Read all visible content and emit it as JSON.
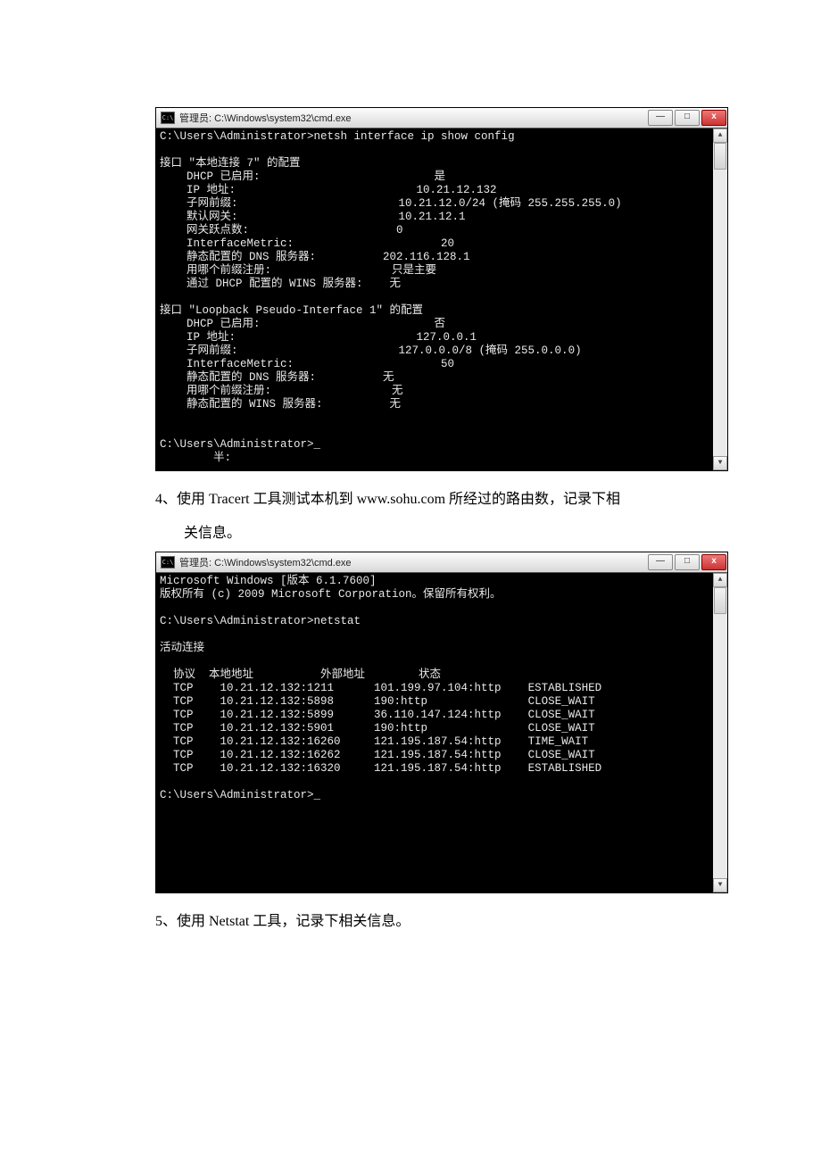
{
  "window1": {
    "title": "管理员: C:\\Windows\\system32\\cmd.exe",
    "icon_text": "C:\\",
    "content": "C:\\Users\\Administrator>netsh interface ip show config\n\n接口 \"本地连接 7\" 的配置\n    DHCP 已启用:                          是\n    IP 地址:                           10.21.12.132\n    子网前缀:                        10.21.12.0/24 (掩码 255.255.255.0)\n    默认网关:                        10.21.12.1\n    网关跃点数:                      0\n    InterfaceMetric:                      20\n    静态配置的 DNS 服务器:          202.116.128.1\n    用哪个前缀注册:                  只是主要\n    通过 DHCP 配置的 WINS 服务器:    无\n\n接口 \"Loopback Pseudo-Interface 1\" 的配置\n    DHCP 已启用:                          否\n    IP 地址:                           127.0.0.1\n    子网前缀:                        127.0.0.0/8 (掩码 255.0.0.0)\n    InterfaceMetric:                      50\n    静态配置的 DNS 服务器:          无\n    用哪个前缀注册:                  无\n    静态配置的 WINS 服务器:          无\n\n\nC:\\Users\\Administrator>_\n        半:"
  },
  "para1": {
    "line1": "4、使用 Tracert 工具测试本机到 www.sohu.com  所经过的路由数，记录下相",
    "line2": "关信息。"
  },
  "window2": {
    "title": "管理员: C:\\Windows\\system32\\cmd.exe",
    "icon_text": "C:\\",
    "content": "Microsoft Windows [版本 6.1.7600]\n版权所有 (c) 2009 Microsoft Corporation。保留所有权利。\n\nC:\\Users\\Administrator>netstat\n\n活动连接\n\n  协议  本地地址          外部地址        状态\n  TCP    10.21.12.132:1211      101.199.97.104:http    ESTABLISHED\n  TCP    10.21.12.132:5898      190:http               CLOSE_WAIT\n  TCP    10.21.12.132:5899      36.110.147.124:http    CLOSE_WAIT\n  TCP    10.21.12.132:5901      190:http               CLOSE_WAIT\n  TCP    10.21.12.132:16260     121.195.187.54:http    TIME_WAIT\n  TCP    10.21.12.132:16262     121.195.187.54:http    CLOSE_WAIT\n  TCP    10.21.12.132:16320     121.195.187.54:http    ESTABLISHED\n\nC:\\Users\\Administrator>_\n\n\n\n\n\n\n"
  },
  "para2": "5、使用 Netstat 工具，记录下相关信息。",
  "buttons": {
    "min": "—",
    "max": "□",
    "close": "x",
    "up": "▲",
    "down": "▼"
  }
}
